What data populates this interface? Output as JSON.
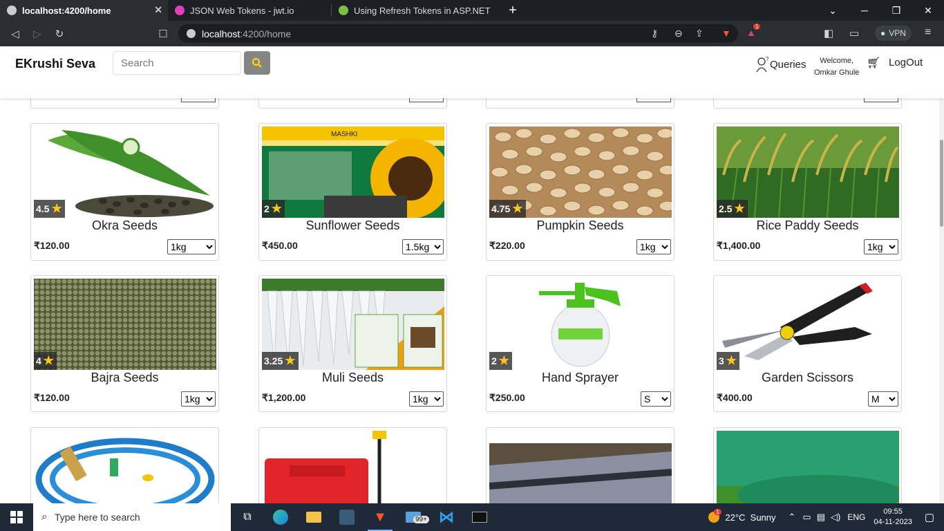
{
  "browser": {
    "tabs": [
      {
        "label": "localhost:4200/home",
        "active": true,
        "favicon_color": "#c8ccd2"
      },
      {
        "label": "JSON Web Tokens - jwt.io",
        "active": false,
        "favicon_color": "#e23fbf"
      },
      {
        "label": "Using Refresh Tokens in ASP.NET Core",
        "active": false,
        "favicon_color": "#7bc043"
      }
    ],
    "new_tab": "+",
    "url_host": "localhost",
    "url_path": ":4200/home",
    "vpn_label": "VPN",
    "brave_badge": "1"
  },
  "header": {
    "brand": "EKrushi Seva",
    "search_placeholder": "Search",
    "queries_label": "Queries",
    "welcome_line1": "Welcome,",
    "welcome_line2": "Omkar Ghule",
    "logout_label": "LogOut"
  },
  "products": [
    {
      "name": "Okra Seeds",
      "rating": "4.5",
      "price": "₹120.00",
      "size": "1kg",
      "size_options": [
        "1kg"
      ],
      "image": "okra"
    },
    {
      "name": "Sunflower Seeds",
      "rating": "2",
      "price": "₹450.00",
      "size": "1.5kg",
      "size_options": [
        "1.5kg"
      ],
      "image": "sunflower"
    },
    {
      "name": "Pumpkin Seeds",
      "rating": "4.75",
      "price": "₹220.00",
      "size": "1kg",
      "size_options": [
        "1kg"
      ],
      "image": "pumpkin"
    },
    {
      "name": "Rice Paddy Seeds",
      "rating": "2.5",
      "price": "₹1,400.00",
      "size": "1kg",
      "size_options": [
        "1kg"
      ],
      "image": "rice"
    },
    {
      "name": "Bajra Seeds",
      "rating": "4",
      "price": "₹120.00",
      "size": "1kg",
      "size_options": [
        "1kg"
      ],
      "image": "bajra"
    },
    {
      "name": "Muli Seeds",
      "rating": "3.25",
      "price": "₹1,200.00",
      "size": "1kg",
      "size_options": [
        "1kg"
      ],
      "image": "muli"
    },
    {
      "name": "Hand Sprayer",
      "rating": "2",
      "price": "₹250.00",
      "size": "S",
      "size_options": [
        "S"
      ],
      "image": "sprayer"
    },
    {
      "name": "Garden Scissors",
      "rating": "3",
      "price": "₹400.00",
      "size": "M",
      "size_options": [
        "M"
      ],
      "image": "scissors"
    }
  ],
  "taskbar": {
    "search_placeholder": "Type here to search",
    "mail_badge": "99+",
    "weather": "22°C  Sunny",
    "weather_badge": "1",
    "language": "ENG",
    "time": "09:55",
    "date": "04-11-2023"
  }
}
